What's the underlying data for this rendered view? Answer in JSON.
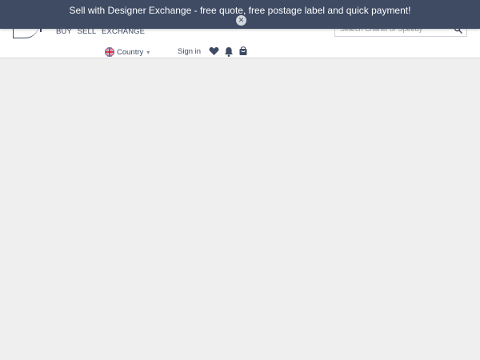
{
  "banner": {
    "message": "Sell with Designer Exchange - free quote, free postage label and quick payment!",
    "close_symbol": "✕",
    "background_color": "#3e4b63"
  },
  "header": {
    "nav_links": [
      "BUY",
      "SELL",
      "EXCHANGE"
    ],
    "search": {
      "placeholder": "Search Chanel or Speedy",
      "value": ""
    },
    "country": {
      "label": "Country",
      "caret": "▾",
      "flag_icon": "uk-flag-icon"
    },
    "sign_in_label": "Sign in",
    "icons": [
      "heart-icon",
      "bell-icon",
      "bag-icon",
      "search-icon"
    ]
  },
  "colors": {
    "accent": "#3e4b63",
    "content_background": "#efefef"
  }
}
